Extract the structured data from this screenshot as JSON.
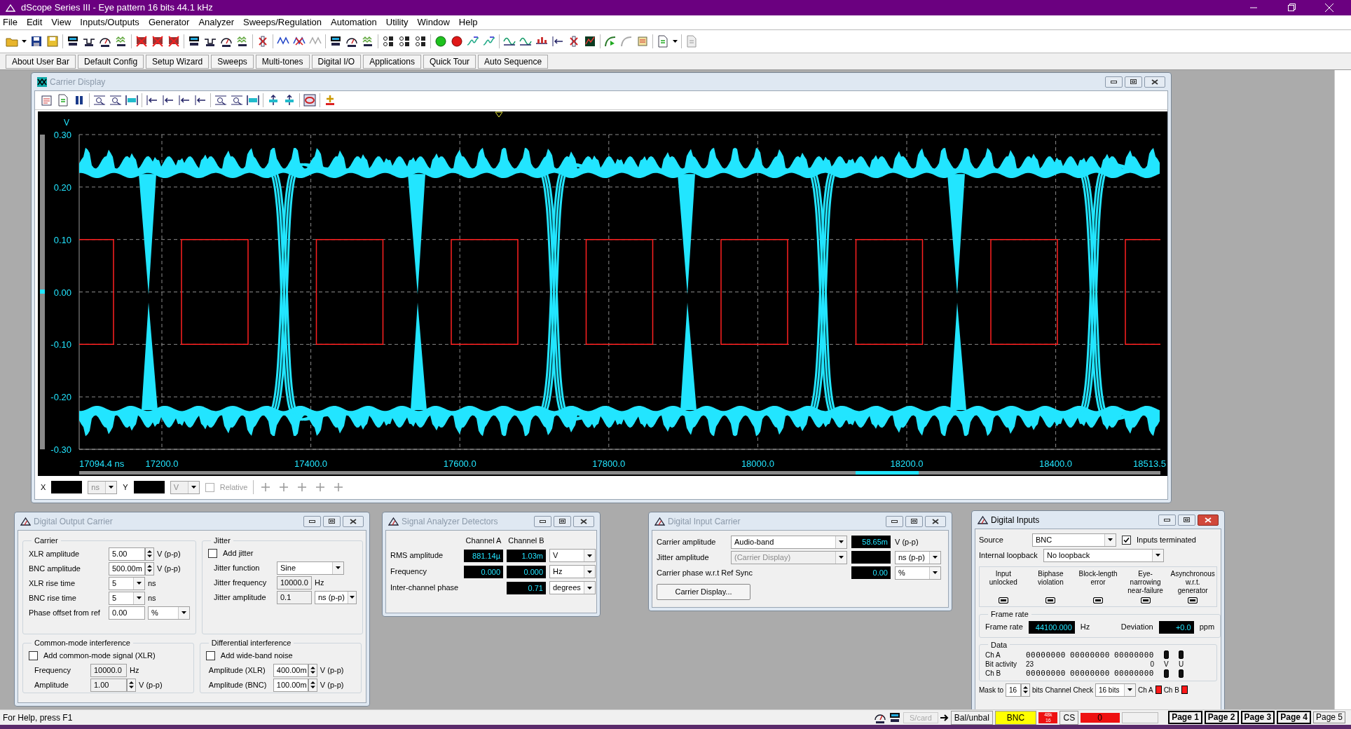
{
  "window": {
    "title": "dScope Series III - Eye pattern 16 bits 44.1 kHz"
  },
  "menu": [
    "File",
    "Edit",
    "View",
    "Inputs/Outputs",
    "Generator",
    "Analyzer",
    "Sweeps/Regulation",
    "Automation",
    "Utility",
    "Window",
    "Help"
  ],
  "user_bar": [
    "About User Bar",
    "Default Config",
    "Setup Wizard",
    "Sweeps",
    "Multi-tones",
    "Digital I/O",
    "Applications",
    "Quick Tour",
    "Auto Sequence"
  ],
  "carrier_display": {
    "title": "Carrier Display",
    "active": false,
    "plot": {
      "y_unit": "V",
      "y_ticks": [
        "0.30",
        "0.20",
        "0.10",
        "0.00",
        "-0.10",
        "-0.20",
        "-0.30"
      ],
      "x_ticks": [
        "17094.4 ns",
        "17200.0",
        "17400.0",
        "17600.0",
        "17800.0",
        "18000.0",
        "18200.0",
        "18400.0",
        "18513.5"
      ]
    },
    "cursor_bar": {
      "x_label": "X",
      "x_unit": "ns",
      "y_label": "Y",
      "y_unit": "V",
      "relative": {
        "label": "Relative",
        "checked": false
      }
    }
  },
  "digital_output_carrier": {
    "title": "Digital Output Carrier",
    "active": false,
    "carrier": {
      "title": "Carrier",
      "rows": [
        {
          "label": "XLR amplitude",
          "value": "5.00",
          "kind": "spin",
          "unit": {
            "text": "V (p-p)",
            "kind": "label"
          },
          "disabled": false
        },
        {
          "label": "BNC amplitude",
          "value": "500.00m",
          "kind": "spin",
          "unit": {
            "text": "V (p-p)",
            "kind": "label"
          },
          "disabled": false
        },
        {
          "label": "XLR rise time",
          "value": "5",
          "kind": "combo",
          "unit": {
            "text": "ns",
            "kind": "label"
          },
          "disabled": false
        },
        {
          "label": "BNC rise time",
          "value": "5",
          "kind": "combo",
          "unit": {
            "text": "ns",
            "kind": "label"
          },
          "disabled": false
        },
        {
          "label": "Phase offset from ref",
          "value": "0.00",
          "kind": "text",
          "unit": {
            "text": "%",
            "kind": "combo"
          },
          "disabled": false
        }
      ]
    },
    "jitter": {
      "title": "Jitter",
      "add": {
        "label": "Add jitter",
        "checked": false
      },
      "rows": [
        {
          "label": "Jitter function",
          "value": "Sine",
          "kind": "wide_combo",
          "disabled": false
        },
        {
          "label": "Jitter frequency",
          "value": "10000.0",
          "kind": "text",
          "unit": {
            "text": "Hz",
            "kind": "label"
          },
          "disabled": true
        },
        {
          "label": "Jitter amplitude",
          "value": "0.1",
          "kind": "text",
          "unit": {
            "text": "ns (p-p)",
            "kind": "combo"
          },
          "disabled": true
        }
      ]
    },
    "common_mode": {
      "title": "Common-mode interference",
      "add": {
        "label": "Add common-mode signal (XLR)",
        "checked": false
      },
      "rows": [
        {
          "label": "Frequency",
          "value": "10000.0",
          "kind": "text",
          "unit": {
            "text": "Hz",
            "kind": "label"
          },
          "disabled": true
        },
        {
          "label": "Amplitude",
          "value": "1.00",
          "kind": "spin",
          "unit": {
            "text": "V (p-p)",
            "kind": "label"
          },
          "disabled": true
        }
      ]
    },
    "differential": {
      "title": "Differential interference",
      "add": {
        "label": "Add wide-band noise",
        "checked": false
      },
      "rows": [
        {
          "label": "Amplitude (XLR)",
          "value": "400.00m",
          "kind": "spin",
          "unit": {
            "text": "V (p-p)",
            "kind": "label"
          },
          "disabled": false
        },
        {
          "label": "Amplitude (BNC)",
          "value": "100.00m",
          "kind": "spin",
          "unit": {
            "text": "V (p-p)",
            "kind": "label"
          },
          "disabled": false
        }
      ]
    }
  },
  "signal_analyzer": {
    "title": "Signal Analyzer Detectors",
    "active": false,
    "columns": [
      "Channel A",
      "Channel B"
    ],
    "rows": [
      {
        "label": "RMS amplitude",
        "readings": [
          {
            "kind": "value",
            "text": "881.14µ"
          },
          {
            "kind": "value",
            "text": "1.03m"
          }
        ],
        "unit": "V"
      },
      {
        "label": "Frequency",
        "readings": [
          {
            "kind": "value",
            "text": "0.000"
          },
          {
            "kind": "value",
            "text": "0.000"
          }
        ],
        "unit": "Hz"
      },
      {
        "label": "Inter-channel phase",
        "readings": [
          {
            "kind": "blank"
          },
          {
            "kind": "value",
            "text": "0.71"
          }
        ],
        "unit": "degrees"
      }
    ]
  },
  "digital_input_carrier": {
    "title": "Digital Input Carrier",
    "active": false,
    "rows": [
      {
        "label": "Carrier amplitude",
        "mode": "Audio-band",
        "mode_disabled": false,
        "reading": "58.65m",
        "unit": {
          "text": "V (p-p)",
          "kind": "label"
        }
      },
      {
        "label": "Jitter amplitude",
        "mode": "(Carrier Display)",
        "mode_disabled": true,
        "unit": {
          "text": "ns (p-p)",
          "kind": "combo"
        }
      },
      {
        "label": "Carrier phase w.r.t Ref Sync",
        "reading": "0.00",
        "unit": {
          "text": "%",
          "kind": "combo"
        }
      }
    ],
    "button": "Carrier Display..."
  },
  "digital_inputs": {
    "title": "Digital Inputs",
    "active": true,
    "source": {
      "label": "Source",
      "value": "BNC"
    },
    "terminated": {
      "label": "Inputs terminated",
      "checked": true
    },
    "loopback": {
      "label": "Internal loopback",
      "value": "No loopback"
    },
    "indicators": [
      {
        "label": "Input unlocked",
        "on": false
      },
      {
        "label": "Biphase violation",
        "on": false
      },
      {
        "label": "Block-length error",
        "on": false
      },
      {
        "label": "Eye-narrowing near-failure",
        "on": false
      },
      {
        "label": "Asynchronous w.r.t. generator",
        "on": false
      }
    ],
    "frame_rate": {
      "title": "Frame rate",
      "label": "Frame rate",
      "reading": "44100.000",
      "unit": "Hz",
      "deviation_label": "Deviation",
      "deviation": "+0.0",
      "deviation_unit": "ppm"
    },
    "data": {
      "title": "Data",
      "ch_a_label": "Ch A",
      "activity_label": "Bit activity",
      "ch_b_label": "Ch B",
      "ch_a_bits": [
        "00000000",
        "00000000",
        "00000000"
      ],
      "ch_b_bits": [
        "00000000",
        "00000000",
        "00000000"
      ],
      "msb": "23",
      "lsb": "0",
      "flags": [
        {
          "label": "V",
          "ch_a": false,
          "ch_b": false
        },
        {
          "label": "U",
          "ch_a": false,
          "ch_b": false
        }
      ]
    },
    "mask": {
      "label": "Mask to",
      "value": "16",
      "unit": "bits"
    },
    "channel_check": {
      "label": "Channel Check",
      "value": "16 bits"
    },
    "checks": [
      {
        "label": "Ch A",
        "on": true
      },
      {
        "label": "Ch B",
        "on": true
      }
    ]
  },
  "status_bar": {
    "help": "For Help, press F1",
    "scard": "S/card",
    "balance": "Bal/unbal",
    "input": "BNC",
    "rate": [
      "48k",
      "16"
    ],
    "cs": "CS",
    "cs_value": "0",
    "pages": [
      {
        "label": "Page 1",
        "active": true
      },
      {
        "label": "Page 2",
        "active": true
      },
      {
        "label": "Page 3",
        "active": true
      },
      {
        "label": "Page 4",
        "active": true
      },
      {
        "label": "Page 5",
        "active": false
      }
    ]
  }
}
